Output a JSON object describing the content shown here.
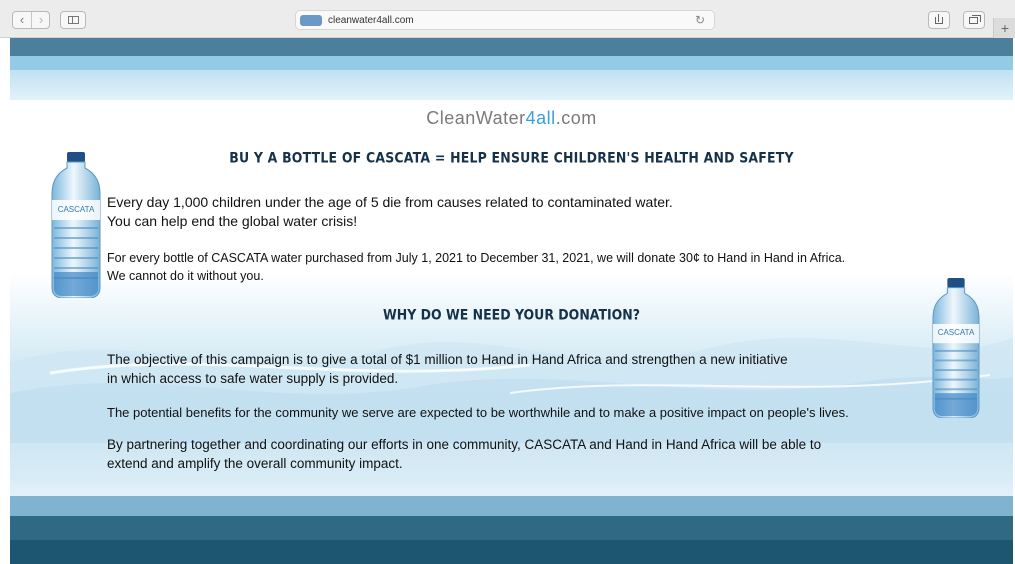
{
  "browser": {
    "url": "cleanwater4all.com",
    "back_icon": "‹",
    "forward_icon": "›",
    "reload_icon": "↻",
    "newtab_icon": "+"
  },
  "page": {
    "site_title_part1": "CleanWater",
    "site_title_part2": "4",
    "site_title_part3": "all",
    "site_title_part4": ".com",
    "headline": "BU Y A BOTTLE OF CASCATA = HELP ENSURE CHILDREN'S HEALTH AND SAFETY",
    "intro_line1": "Every day 1,000 children under the age of 5 die from causes related to contaminated water.",
    "intro_line2": "You can help end the global water crisis!",
    "donation_line1": "For every bottle of CASCATA water purchased from July 1, 2021 to December 31, 2021, we will donate 30¢ to Hand in Hand in Africa.",
    "donation_line2": "We cannot do it without you.",
    "why_heading": "WHY DO WE NEED YOUR DONATION?",
    "objective_line1": "The objective of this campaign is to give a total of $1 million to Hand in Hand Africa and strengthen a new initiative",
    "objective_line2": "in which access to safe water supply is provided.",
    "benefits": "The potential benefits for the community we serve are expected to be worthwhile and to make a positive impact on people's lives.",
    "partnering_line1": "By partnering together and coordinating our efforts in one community, CASCATA and Hand in Hand Africa will be able to",
    "partnering_line2": "extend and amplify the overall community impact.",
    "bottle_label": "CASCATA"
  },
  "colors": {
    "accent_blue": "#3aa0d8",
    "heading_navy": "#15324a",
    "band_dark": "#1d5670",
    "band_light": "#93cbe4"
  }
}
